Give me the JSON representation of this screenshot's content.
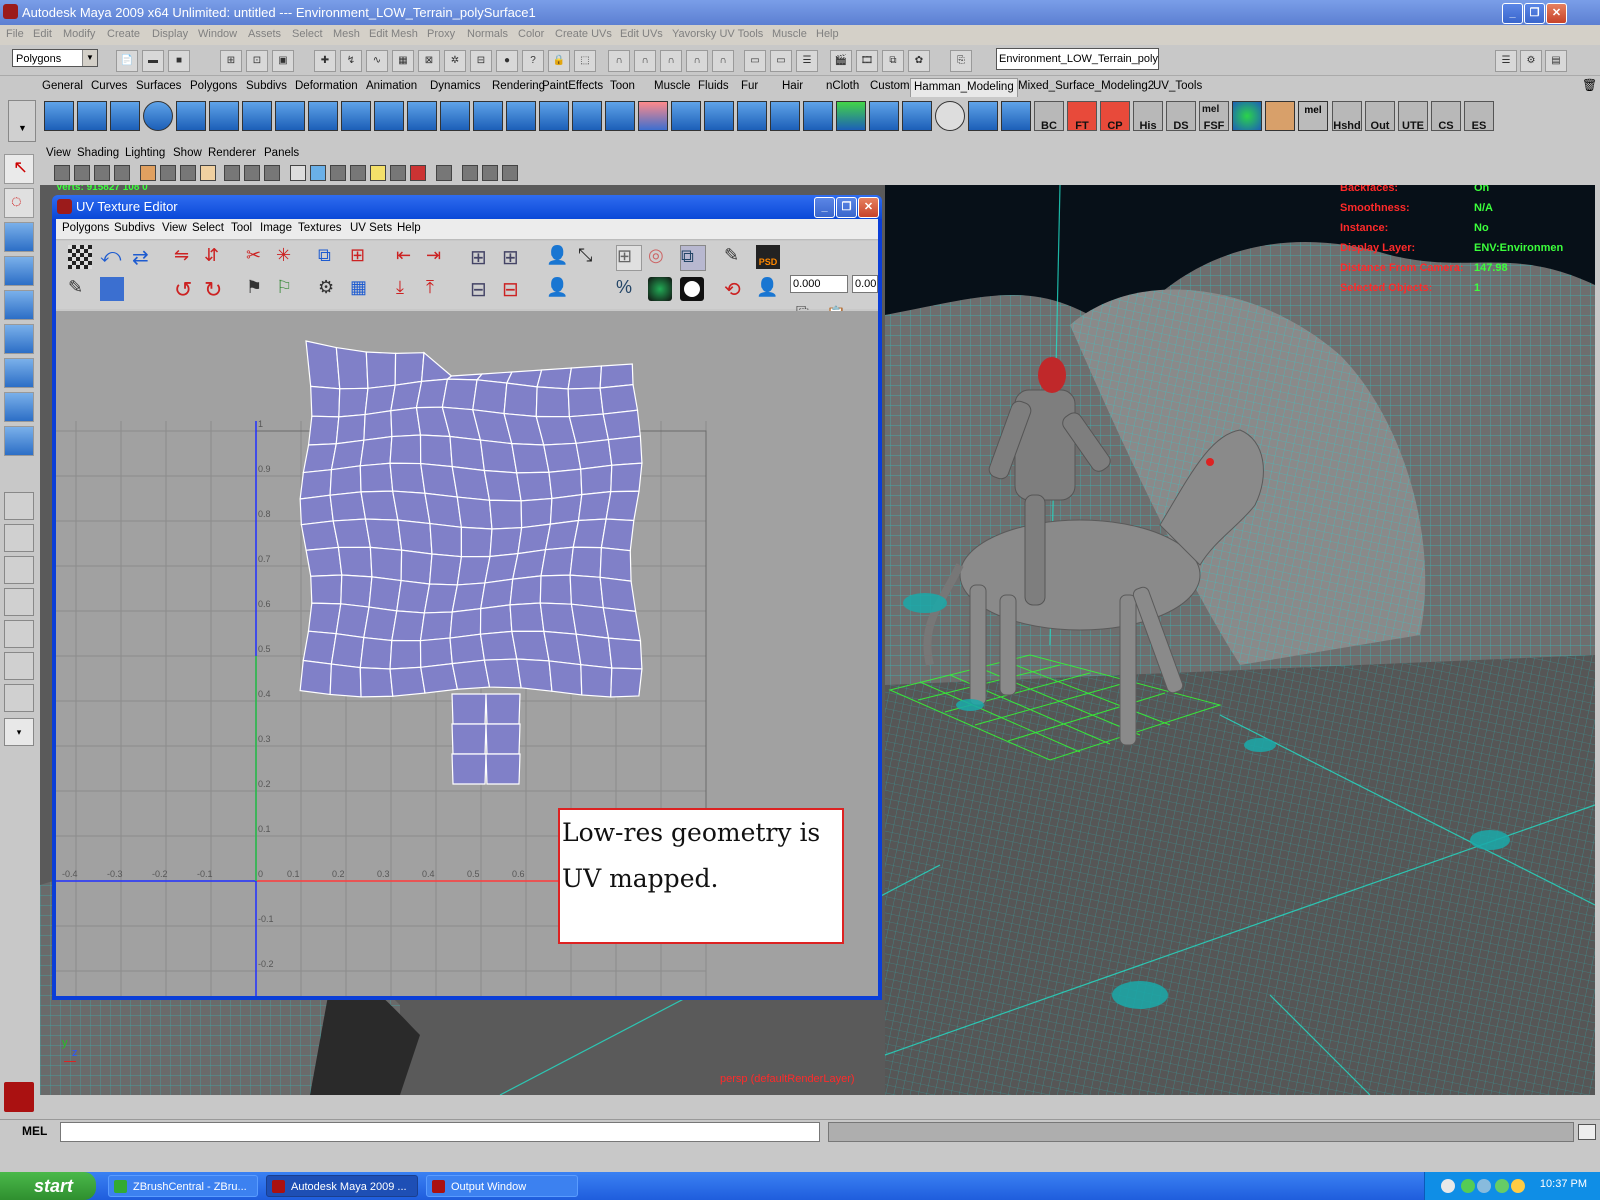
{
  "window": {
    "title": "Autodesk Maya 2009 x64 Unlimited: untitled    ---    Environment_LOW_Terrain_polySurface1",
    "min_glyph": "_",
    "max_glyph": "❐",
    "close_glyph": "✕"
  },
  "menubar": [
    "File",
    "Edit",
    "Modify",
    "Create",
    "Display",
    "Window",
    "Assets",
    "Select",
    "Mesh",
    "Edit Mesh",
    "Proxy",
    "Normals",
    "Color",
    "Create UVs",
    "Edit UVs",
    "Yavorsky UV Tools",
    "Muscle",
    "Help"
  ],
  "statusline": {
    "mode": "Polygons",
    "object_field": "Environment_LOW_Terrain_polyS"
  },
  "shelf": {
    "tabs": [
      "General",
      "Curves",
      "Surfaces",
      "Polygons",
      "Subdivs",
      "Deformation",
      "Animation",
      "Dynamics",
      "Rendering",
      "PaintEffects",
      "Toon",
      "Muscle",
      "Fluids",
      "Fur",
      "Hair",
      "nCloth",
      "Custom",
      "Hamman_Modeling",
      "Mixed_Surface_Modeling2",
      "UV_Tools"
    ],
    "active_tab": "Hamman_Modeling",
    "text_buttons": [
      "BC",
      "FT",
      "CP",
      "His",
      "DS",
      "FSF",
      "Hshd",
      "Out",
      "UTE",
      "CS",
      "ES"
    ],
    "mel_labels": [
      "mel",
      "mel"
    ]
  },
  "panel": {
    "menu": [
      "View",
      "Shading",
      "Lighting",
      "Show",
      "Renderer",
      "Panels"
    ],
    "hud_top": "Verts:   915827   108       0",
    "hud": [
      {
        "key": "Backfaces:",
        "value": "On"
      },
      {
        "key": "Smoothness:",
        "value": "N/A"
      },
      {
        "key": "Instance:",
        "value": "No"
      },
      {
        "key": "Display Layer:",
        "value": "ENV:Environmen"
      },
      {
        "key": "Distance From Camera:",
        "value": "147.98"
      },
      {
        "key": "Selected Objects:",
        "value": "1"
      }
    ],
    "camera_label": "persp (defaultRenderLayer)",
    "axis_y": "y",
    "axis_z": "z"
  },
  "uv_editor": {
    "title": "UV Texture Editor",
    "menu": [
      "Polygons",
      "Subdivs",
      "View",
      "Select",
      "Tool",
      "Image",
      "Textures",
      "UV Sets",
      "Help"
    ],
    "field1": "0.000",
    "field2": "0.00",
    "ticks_v": [
      "1",
      "0.9",
      "0.8",
      "0.7",
      "0.6",
      "0.5",
      "0.4",
      "0.3",
      "0.2",
      "0.1",
      "0",
      "-0.1",
      "-0.2"
    ],
    "ticks_u": [
      "-0.4",
      "-0.3",
      "-0.2",
      "-0.1",
      "0",
      "0.1",
      "0.2",
      "0.3",
      "0.4",
      "0.5",
      "0.6"
    ],
    "colors": {
      "uv_shell": "#8080c8",
      "grid": "#8c8c8c",
      "u_axis": "#ff3b3b",
      "v_axis": "#2030ff"
    }
  },
  "callout": {
    "text": "Low-res geometry is UV mapped."
  },
  "command_line": {
    "label": "MEL"
  },
  "taskbar": {
    "start": "start",
    "tasks": [
      "ZBrushCentral - ZBru...",
      "Autodesk Maya 2009 ...",
      "Output Window"
    ],
    "active_task": 1,
    "clock": "10:37 PM"
  },
  "viewport_colors": {
    "wireframe": "#22d6d6",
    "ground_grid": "#33ff33",
    "character_head": "#c0282a"
  }
}
